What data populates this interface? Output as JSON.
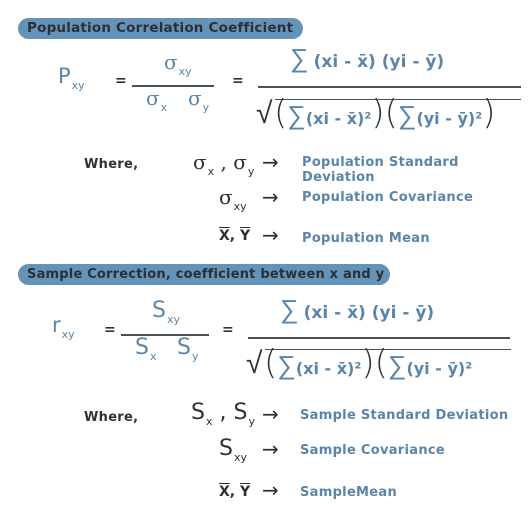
{
  "colors": {
    "header_pill": "#6593b8",
    "accent_text": "#5b85a8",
    "dark_text": "#2d3138"
  },
  "population": {
    "header": "Population Correlation Coefficient",
    "lhs_symbol": "P",
    "lhs_sub": "xy",
    "equals": "=",
    "frac1": {
      "num_symbol": "σ",
      "num_sub": "xy",
      "den_a_symbol": "σ",
      "den_a_sub": "x",
      "den_b_symbol": "σ",
      "den_b_sub": "y"
    },
    "frac2": {
      "numerator": "(xi - x̄) (yi - ȳ)",
      "sum_symbol": "∑",
      "den_left": "(xi - x̄)²",
      "den_right": "(yi - ȳ)²",
      "sqrt_symbol": "√"
    },
    "where_label": "Where,",
    "definitions": [
      {
        "symbol": "σx , σy",
        "arrow": "→",
        "meaning": "Population Standard Deviation"
      },
      {
        "symbol": "σxy",
        "arrow": "→",
        "meaning": "Population Covariance"
      },
      {
        "symbol": "X̄, Ȳ",
        "arrow": "→",
        "meaning": "Population Mean"
      }
    ]
  },
  "sample": {
    "header": "Sample Correction, coefficient between x and y",
    "lhs_symbol": "r",
    "lhs_sub": "xy",
    "equals": "=",
    "frac1": {
      "num_symbol": "S",
      "num_sub": "xy",
      "den_a_symbol": "S",
      "den_a_sub": "x",
      "den_b_symbol": "S",
      "den_b_sub": "y"
    },
    "frac2": {
      "numerator": "(xi - x̄) (yi - ȳ)",
      "sum_symbol": "∑",
      "den_left": "(xi - x̄)²",
      "den_right": "(yi - ȳ)²",
      "sqrt_symbol": "√"
    },
    "where_label": "Where,",
    "definitions": [
      {
        "symbol": "Sx , Sy",
        "arrow": "→",
        "meaning": "Sample Standard Deviation"
      },
      {
        "symbol": "Sxy",
        "arrow": "→",
        "meaning": "Sample Covariance"
      },
      {
        "symbol": "X̄, Ȳ",
        "arrow": "→",
        "meaning": "SampleMean"
      }
    ]
  }
}
